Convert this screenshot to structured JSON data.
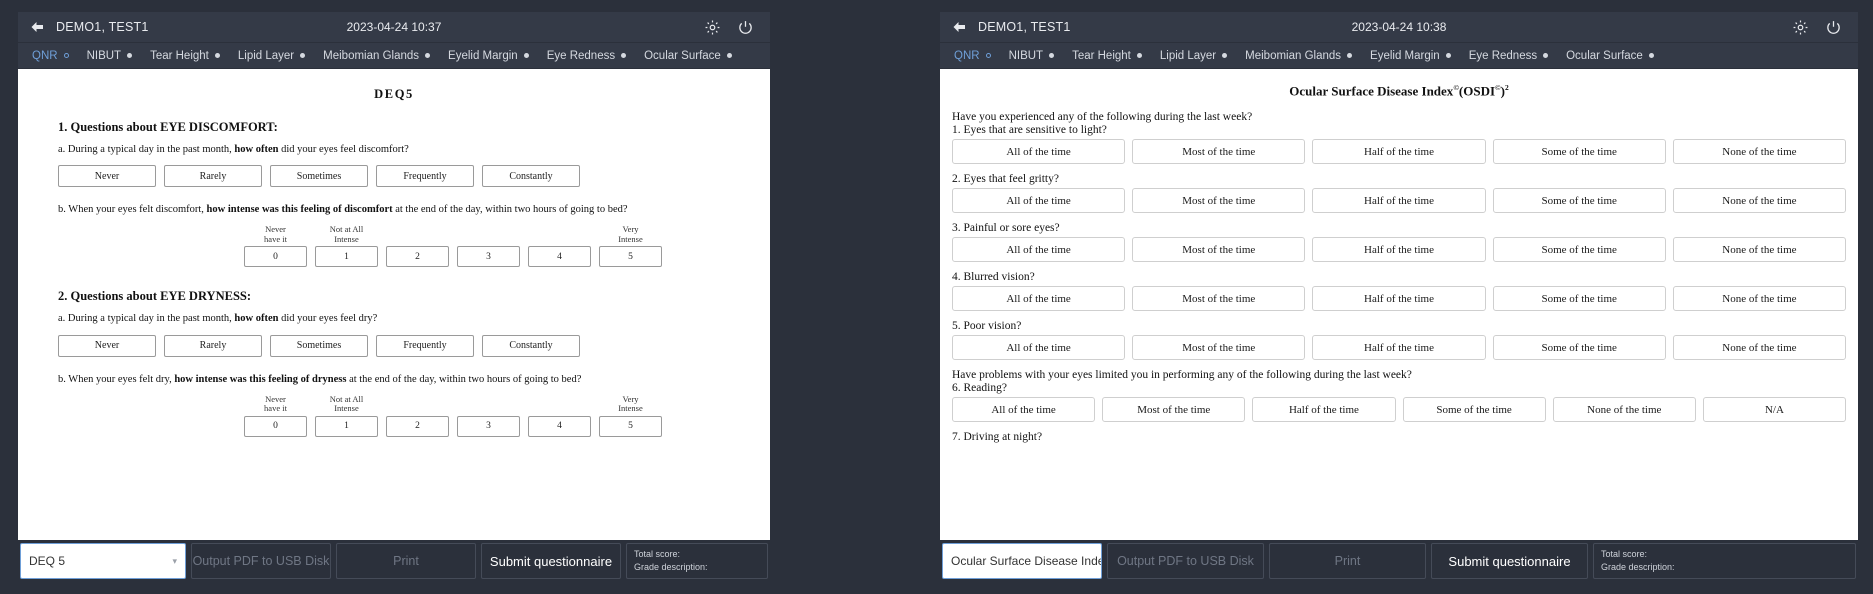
{
  "panels": {
    "left": {
      "header": {
        "back_icon": "back-arrow-icon",
        "patient": "DEMO1, TEST1",
        "datetime": "2023-04-24 10:37",
        "settings_icon": "gear-icon",
        "power_icon": "power-icon"
      },
      "tabs": [
        {
          "label": "QNR",
          "active": true
        },
        {
          "label": "NIBUT",
          "active": false
        },
        {
          "label": "Tear Height",
          "active": false
        },
        {
          "label": "Lipid Layer",
          "active": false
        },
        {
          "label": "Meibomian Glands",
          "active": false
        },
        {
          "label": "Eyelid Margin",
          "active": false
        },
        {
          "label": "Eye Redness",
          "active": false
        },
        {
          "label": "Ocular Surface",
          "active": false
        }
      ],
      "document": {
        "title": "DEQ5",
        "sections": [
          {
            "heading": "1. Questions about EYE DISCOMFORT:",
            "qa_prefix": "a. During a typical day in the past month, ",
            "qa_bold": "how often",
            "qa_suffix": " did your eyes feel discomfort?",
            "frequency_options": [
              "Never",
              "Rarely",
              "Sometimes",
              "Frequently",
              "Constantly"
            ],
            "qb_prefix": "b. When your eyes felt discomfort, ",
            "qb_bold": "how intense was this feeling of discomfort",
            "qb_suffix": " at the end of the day, within two hours of going to bed?",
            "scale_labels": [
              "Never\nhave it",
              "Not at All\nIntense",
              "",
              "",
              "",
              "Very\nIntense"
            ],
            "scale_values": [
              "0",
              "1",
              "2",
              "3",
              "4",
              "5"
            ]
          },
          {
            "heading": "2. Questions about EYE DRYNESS:",
            "qa_prefix": "a. During a typical day in the past month, ",
            "qa_bold": "how often",
            "qa_suffix": " did your eyes feel dry?",
            "frequency_options": [
              "Never",
              "Rarely",
              "Sometimes",
              "Frequently",
              "Constantly"
            ],
            "qb_prefix": "b. When your eyes felt dry, ",
            "qb_bold": "how intense was this feeling of dryness",
            "qb_suffix": " at the end of the day, within two hours of going to bed?",
            "scale_labels": [
              "Never\nhave it",
              "Not at All\nIntense",
              "",
              "",
              "",
              "Very\nIntense"
            ],
            "scale_values": [
              "0",
              "1",
              "2",
              "3",
              "4",
              "5"
            ]
          }
        ]
      },
      "toolbar": {
        "selected_questionnaire": "DEQ 5",
        "output_pdf_label": "Output PDF to USB Disk",
        "print_label": "Print",
        "submit_label": "Submit questionnaire",
        "total_score_label": "Total score:",
        "grade_description_label": "Grade description:"
      }
    },
    "right": {
      "header": {
        "back_icon": "back-arrow-icon",
        "patient": "DEMO1, TEST1",
        "datetime": "2023-04-24 10:38",
        "settings_icon": "gear-icon",
        "power_icon": "power-icon"
      },
      "tabs": [
        {
          "label": "QNR",
          "active": true
        },
        {
          "label": "NIBUT",
          "active": false
        },
        {
          "label": "Tear Height",
          "active": false
        },
        {
          "label": "Lipid Layer",
          "active": false
        },
        {
          "label": "Meibomian Glands",
          "active": false
        },
        {
          "label": "Eyelid Margin",
          "active": false
        },
        {
          "label": "Eye Redness",
          "active": false
        },
        {
          "label": "Ocular Surface",
          "active": false
        }
      ],
      "document": {
        "title_main": "Ocular Surface Disease Index",
        "title_sup1": "©",
        "title_mid": "(OSDI",
        "title_sup2": "©",
        "title_close": ")",
        "title_sup3": "2",
        "lead1": "Have you experienced any of the following during the last week?",
        "lead2": "Have problems with your eyes limited you in performing any of the following during the last week?",
        "questions": [
          {
            "label": "1. Eyes that are sensitive to light?",
            "options": [
              "All of the time",
              "Most of the time",
              "Half of the time",
              "Some of the time",
              "None of the time"
            ]
          },
          {
            "label": "2. Eyes that feel gritty?",
            "options": [
              "All of the time",
              "Most of the time",
              "Half of the time",
              "Some of the time",
              "None of the time"
            ]
          },
          {
            "label": "3. Painful or sore eyes?",
            "options": [
              "All of the time",
              "Most of the time",
              "Half of the time",
              "Some of the time",
              "None of the time"
            ]
          },
          {
            "label": "4. Blurred vision?",
            "options": [
              "All of the time",
              "Most of the time",
              "Half of the time",
              "Some of the time",
              "None of the time"
            ]
          },
          {
            "label": "5. Poor vision?",
            "options": [
              "All of the time",
              "Most of the time",
              "Half of the time",
              "Some of the time",
              "None of the time"
            ]
          },
          {
            "label": "6. Reading?",
            "options": [
              "All of the time",
              "Most of the time",
              "Half of the time",
              "Some of the time",
              "None of the time",
              "N/A"
            ]
          },
          {
            "label": "7. Driving at night?",
            "options": []
          }
        ]
      },
      "toolbar": {
        "selected_questionnaire": "Ocular Surface Disease Index©(O",
        "output_pdf_label": "Output PDF to USB Disk",
        "print_label": "Print",
        "submit_label": "Submit questionnaire",
        "total_score_label": "Total score:",
        "grade_description_label": "Grade description:"
      }
    }
  },
  "colors": {
    "window_bg": "#2b303b",
    "header_bg": "#343a47",
    "accent": "#6f9fd8",
    "doc_bg": "#ffffff",
    "text_light": "#e9ebef"
  }
}
